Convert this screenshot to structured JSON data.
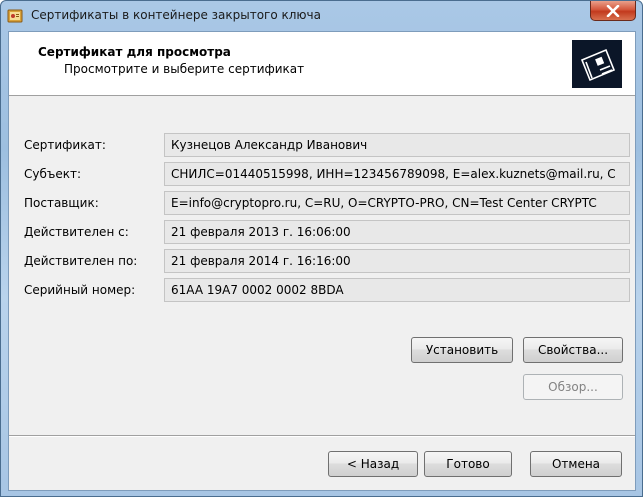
{
  "window": {
    "title": "Сертификаты в контейнере закрытого ключа"
  },
  "header": {
    "title": "Сертификат для просмотра",
    "subtitle": "Просмотрите и выберите сертификат"
  },
  "fields": [
    {
      "label": "Сертификат:",
      "value": "Кузнецов Александр Иванович"
    },
    {
      "label": "Субъект:",
      "value": "СНИЛС=01440515998, ИНН=123456789098, E=alex.kuznets@mail.ru, С"
    },
    {
      "label": "Поставщик:",
      "value": "E=info@cryptopro.ru, C=RU, O=CRYPTO-PRO, CN=Test Center CRYPTC"
    },
    {
      "label": "Действителен с:",
      "value": "21 февраля 2013 г. 16:06:00"
    },
    {
      "label": "Действителен по:",
      "value": "21 февраля 2014 г. 16:16:00"
    },
    {
      "label": "Серийный номер:",
      "value": "61AA 19A7 0002 0002 8BDA"
    }
  ],
  "actions": {
    "install": "Установить",
    "properties": "Свойства...",
    "browse": "Обзор..."
  },
  "footer": {
    "back": "< Назад",
    "finish": "Готово",
    "cancel": "Отмена"
  },
  "icons": {
    "app": "certificate-app-icon",
    "close": "close-icon",
    "logo": "certificate-logo-icon"
  }
}
